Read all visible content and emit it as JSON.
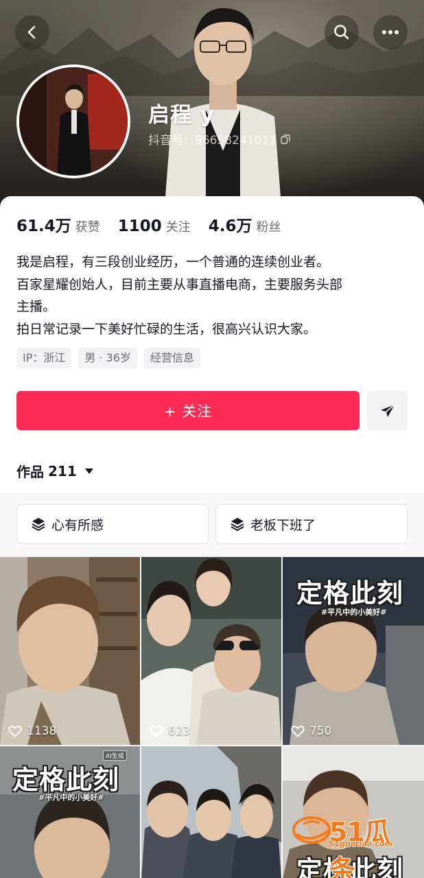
{
  "profile": {
    "nickname": "启程 y",
    "douyin_id": "抖音号：96658241012"
  },
  "stats": [
    {
      "value": "61.4万",
      "label": "获赞"
    },
    {
      "value": "1100",
      "label": "关注"
    },
    {
      "value": "4.6万",
      "label": "粉丝"
    }
  ],
  "bio": [
    "我是启程，有三段创业经历，一个普通的连续创业者。",
    "百家星耀创始人，目前主要从事直播电商，主要服务头部",
    "主播。",
    "拍日常记录一下美好忙碌的生活，很高兴认识大家。"
  ],
  "tags": [
    "IP：浙江",
    "男 · 36岁",
    "经营信息"
  ],
  "actions": {
    "follow_label": "+ 关注"
  },
  "works": {
    "label": "作品",
    "count": "211"
  },
  "collections": [
    "心有所感",
    "老板下班了"
  ],
  "videos": [
    {
      "likes": "1138"
    },
    {
      "likes": "623"
    },
    {
      "likes": "750",
      "overlay_title": "定格此刻",
      "overlay_sub": "#平凡中的小美好#"
    },
    {
      "overlay_title": "定格此刻",
      "overlay_sub": "#平凡中的小美好#",
      "badge": "AI生成"
    },
    {},
    {
      "overlay_title": "定格此刻"
    }
  ],
  "watermark": {
    "main": "51瓜条",
    "sub": "51guatiao.com"
  },
  "colors": {
    "accent": "#fe2c55",
    "text_primary": "#161823",
    "text_secondary": "#6b6d73"
  }
}
